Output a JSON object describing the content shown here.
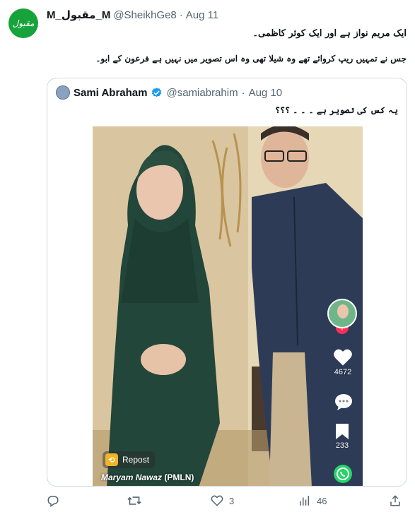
{
  "author": {
    "avatar_text": "مقبول",
    "display_name": "M_مقبول_M",
    "handle": "@SheikhGe8",
    "separator": "·",
    "date": "Aug 11"
  },
  "tweet": {
    "line1": "ایک مریم نواز ہے اور ایک کوثر کاظمی۔",
    "line2": "جس نے تمہیں ریپ کروائے تھے وہ شیلا تھی وہ اس تصویر میں نہیں ہے فرعون کے ابو۔"
  },
  "quoted_tweet": {
    "display_name": "Sami Abraham",
    "handle": "@samiabrahim",
    "separator": "·",
    "date": "Aug 10",
    "text": "یہ کس کی تصویر ہے ۔ ۔ ۔ ؟؟؟",
    "video": {
      "like_count": "4672",
      "bookmark_count": "233",
      "repost_label": "Repost",
      "caption_name": "Maryam Nawaz",
      "caption_party": "(PMLN)"
    }
  },
  "actions": {
    "reply_count": "",
    "retweet_count": "",
    "like_count": "3",
    "views_count": "46"
  },
  "colors": {
    "avatar_bg": "#17a33b",
    "verified": "#1d9bf0",
    "muted_text": "#536471",
    "border": "#cfd9de"
  }
}
